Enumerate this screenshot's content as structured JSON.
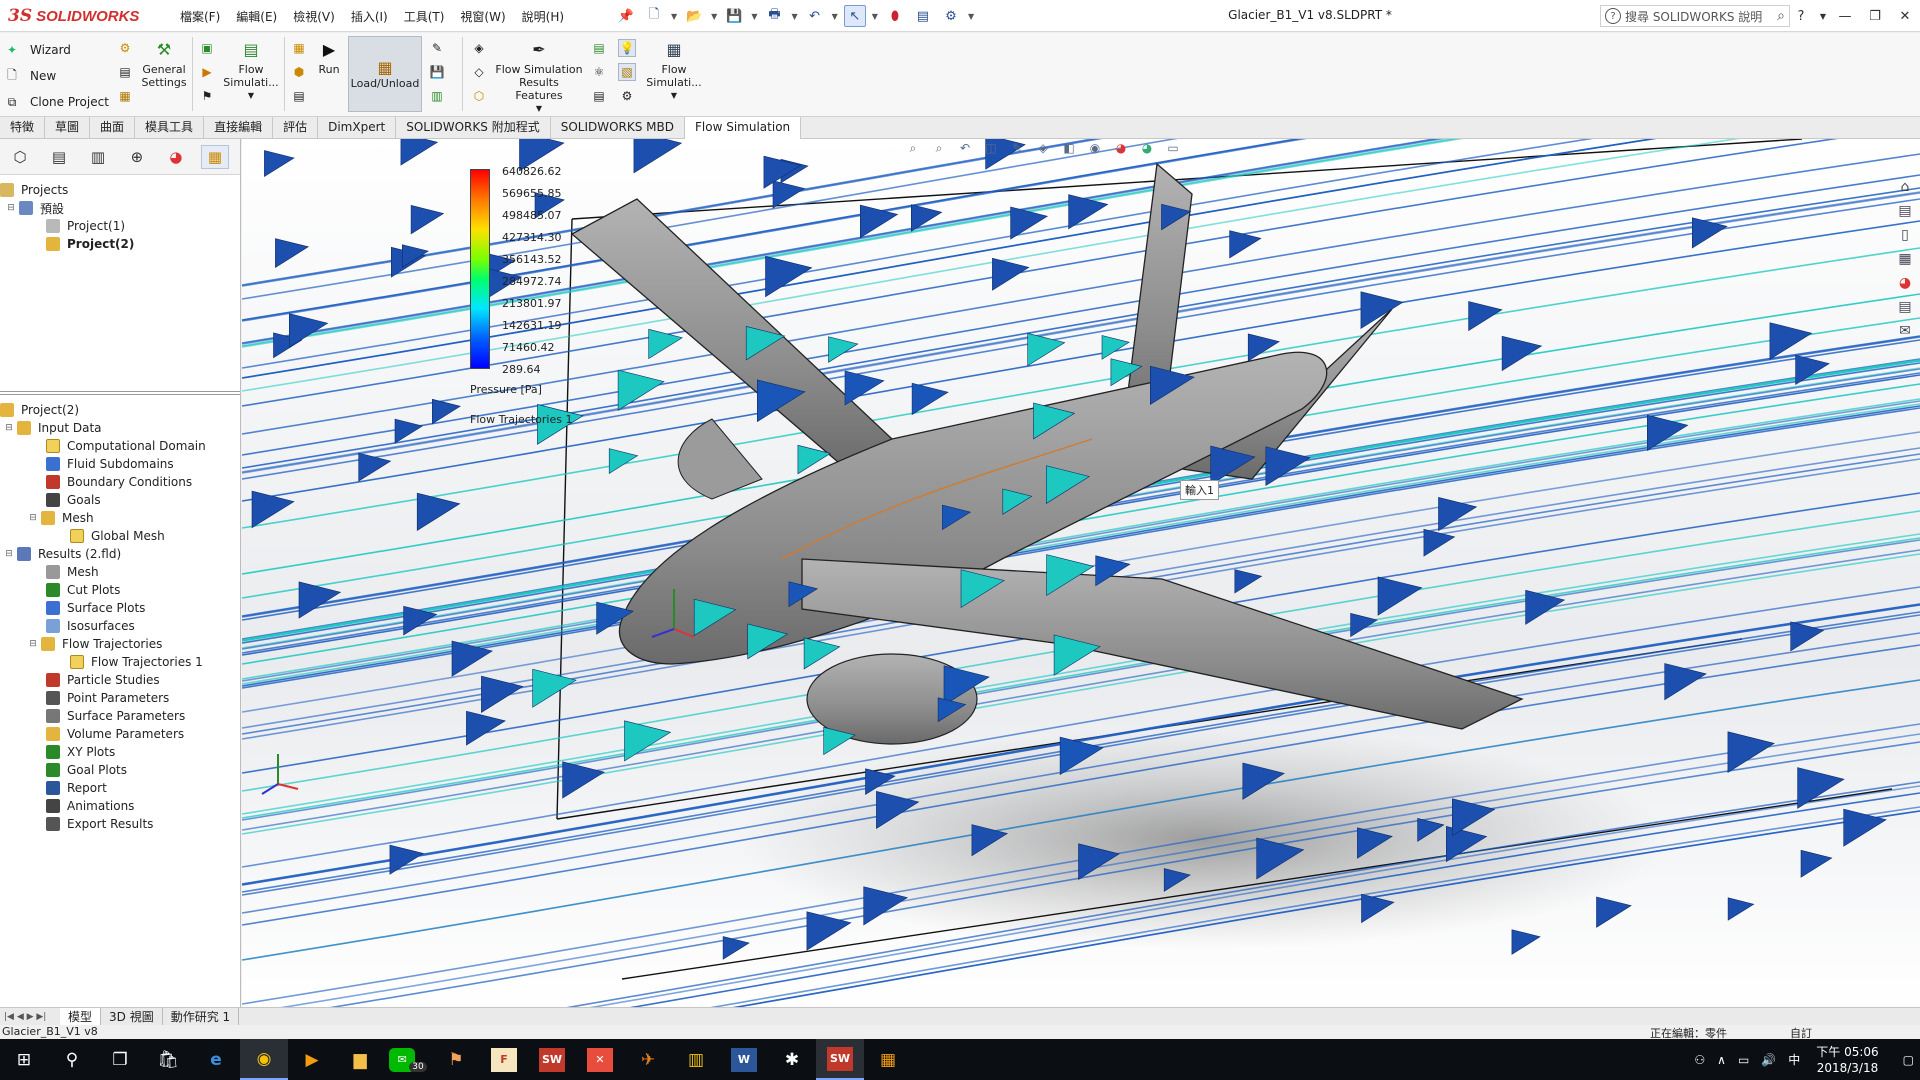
{
  "app": {
    "logo_text": "SOLIDWORKS",
    "document_title": "Glacier_B1_V1 v8.SLDPRT *",
    "menu": [
      "檔案(F)",
      "編輯(E)",
      "檢視(V)",
      "插入(I)",
      "工具(T)",
      "視窗(W)",
      "說明(H)"
    ],
    "help_search_placeholder": "搜尋 SOLIDWORKS 說明"
  },
  "command_manager": {
    "wizard": "Wizard",
    "new": "New",
    "clone_project": "Clone Project",
    "general_settings": "General Settings",
    "flow_simulation_1": "Flow Simulati...",
    "run": "Run",
    "load_unload": "Load/Unload",
    "results_features": "Flow Simulation Results Features",
    "flow_simulation_2": "Flow Simulati..."
  },
  "tabs": [
    "特徵",
    "草圖",
    "曲面",
    "模具工具",
    "直接編輯",
    "評估",
    "DimXpert",
    "SOLIDWORKS 附加程式",
    "SOLIDWORKS MBD",
    "Flow Simulation"
  ],
  "active_tab": "Flow Simulation",
  "project_tree": {
    "root": "Projects",
    "config": "預設",
    "projects": [
      "Project(1)",
      "Project(2)"
    ]
  },
  "analysis_tree": {
    "root": "Project(2)",
    "input_data": "Input Data",
    "input_children": [
      "Computational Domain",
      "Fluid Subdomains",
      "Boundary Conditions",
      "Goals"
    ],
    "mesh": "Mesh",
    "global_mesh": "Global Mesh",
    "results": "Results (2.fld)",
    "results_children_a": [
      "Mesh",
      "Cut Plots",
      "Surface Plots",
      "Isosurfaces"
    ],
    "flow_trajectories": "Flow Trajectories",
    "flow_trajectories_1": "Flow Trajectories 1",
    "results_children_b": [
      "Particle Studies",
      "Point Parameters",
      "Surface Parameters",
      "Volume Parameters",
      "XY Plots",
      "Goal Plots",
      "Report",
      "Animations",
      "Export Results"
    ]
  },
  "legend": {
    "values": [
      "640826.62",
      "569655.85",
      "498485.07",
      "427314.30",
      "356143.52",
      "284972.74",
      "213801.97",
      "142631.19",
      "71460.42",
      "289.64"
    ],
    "caption": "Pressure [Pa]",
    "plot_name": "Flow Trajectories 1"
  },
  "tooltip": "輸入1",
  "bottom_tabs": [
    "模型",
    "3D 視圖",
    "動作研究 1"
  ],
  "status": {
    "filename": "Glacier_B1_V1 v8",
    "editing": "正在編輯：零件",
    "custom": "自訂"
  },
  "taskbar": {
    "clock_time": "下午 05:06",
    "clock_date": "2018/3/18",
    "line_badge": "30",
    "ime": "中"
  },
  "colors": {
    "accent": "#d32f2f",
    "fast_flow": "#1f5fc2",
    "slow_flow": "#1cc8c0",
    "hull": "#8f8f8f"
  }
}
